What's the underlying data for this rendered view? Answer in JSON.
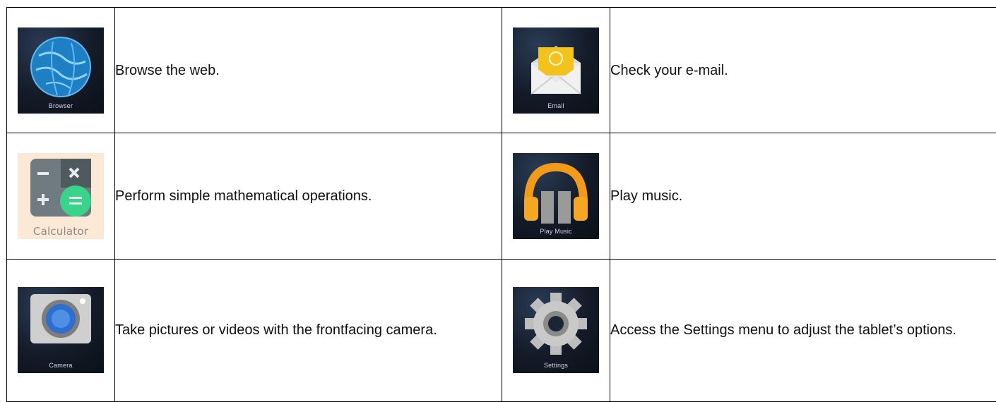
{
  "top_fragment": "",
  "rows": [
    {
      "left": {
        "icon": "browser-icon",
        "caption": "Browser",
        "text": "Browse the web."
      },
      "right": {
        "icon": "email-icon",
        "caption": "Email",
        "text": "Check your e-mail."
      }
    },
    {
      "left": {
        "icon": "calculator-icon",
        "caption": "Calculator",
        "text": "Perform simple mathematical operations."
      },
      "right": {
        "icon": "play-music-icon",
        "caption": "Play Music",
        "text": "Play music."
      }
    },
    {
      "left": {
        "icon": "camera-icon",
        "caption": "Camera",
        "text": "Take pictures or videos with the frontfacing camera."
      },
      "right": {
        "icon": "settings-icon",
        "caption": "Settings",
        "text": "Access the Settings menu to adjust the tablet’s options."
      }
    }
  ],
  "colors": {
    "border": "#000000",
    "calculator_bg": "#fbe9d6",
    "icon_dark_bg": "#141b28"
  }
}
